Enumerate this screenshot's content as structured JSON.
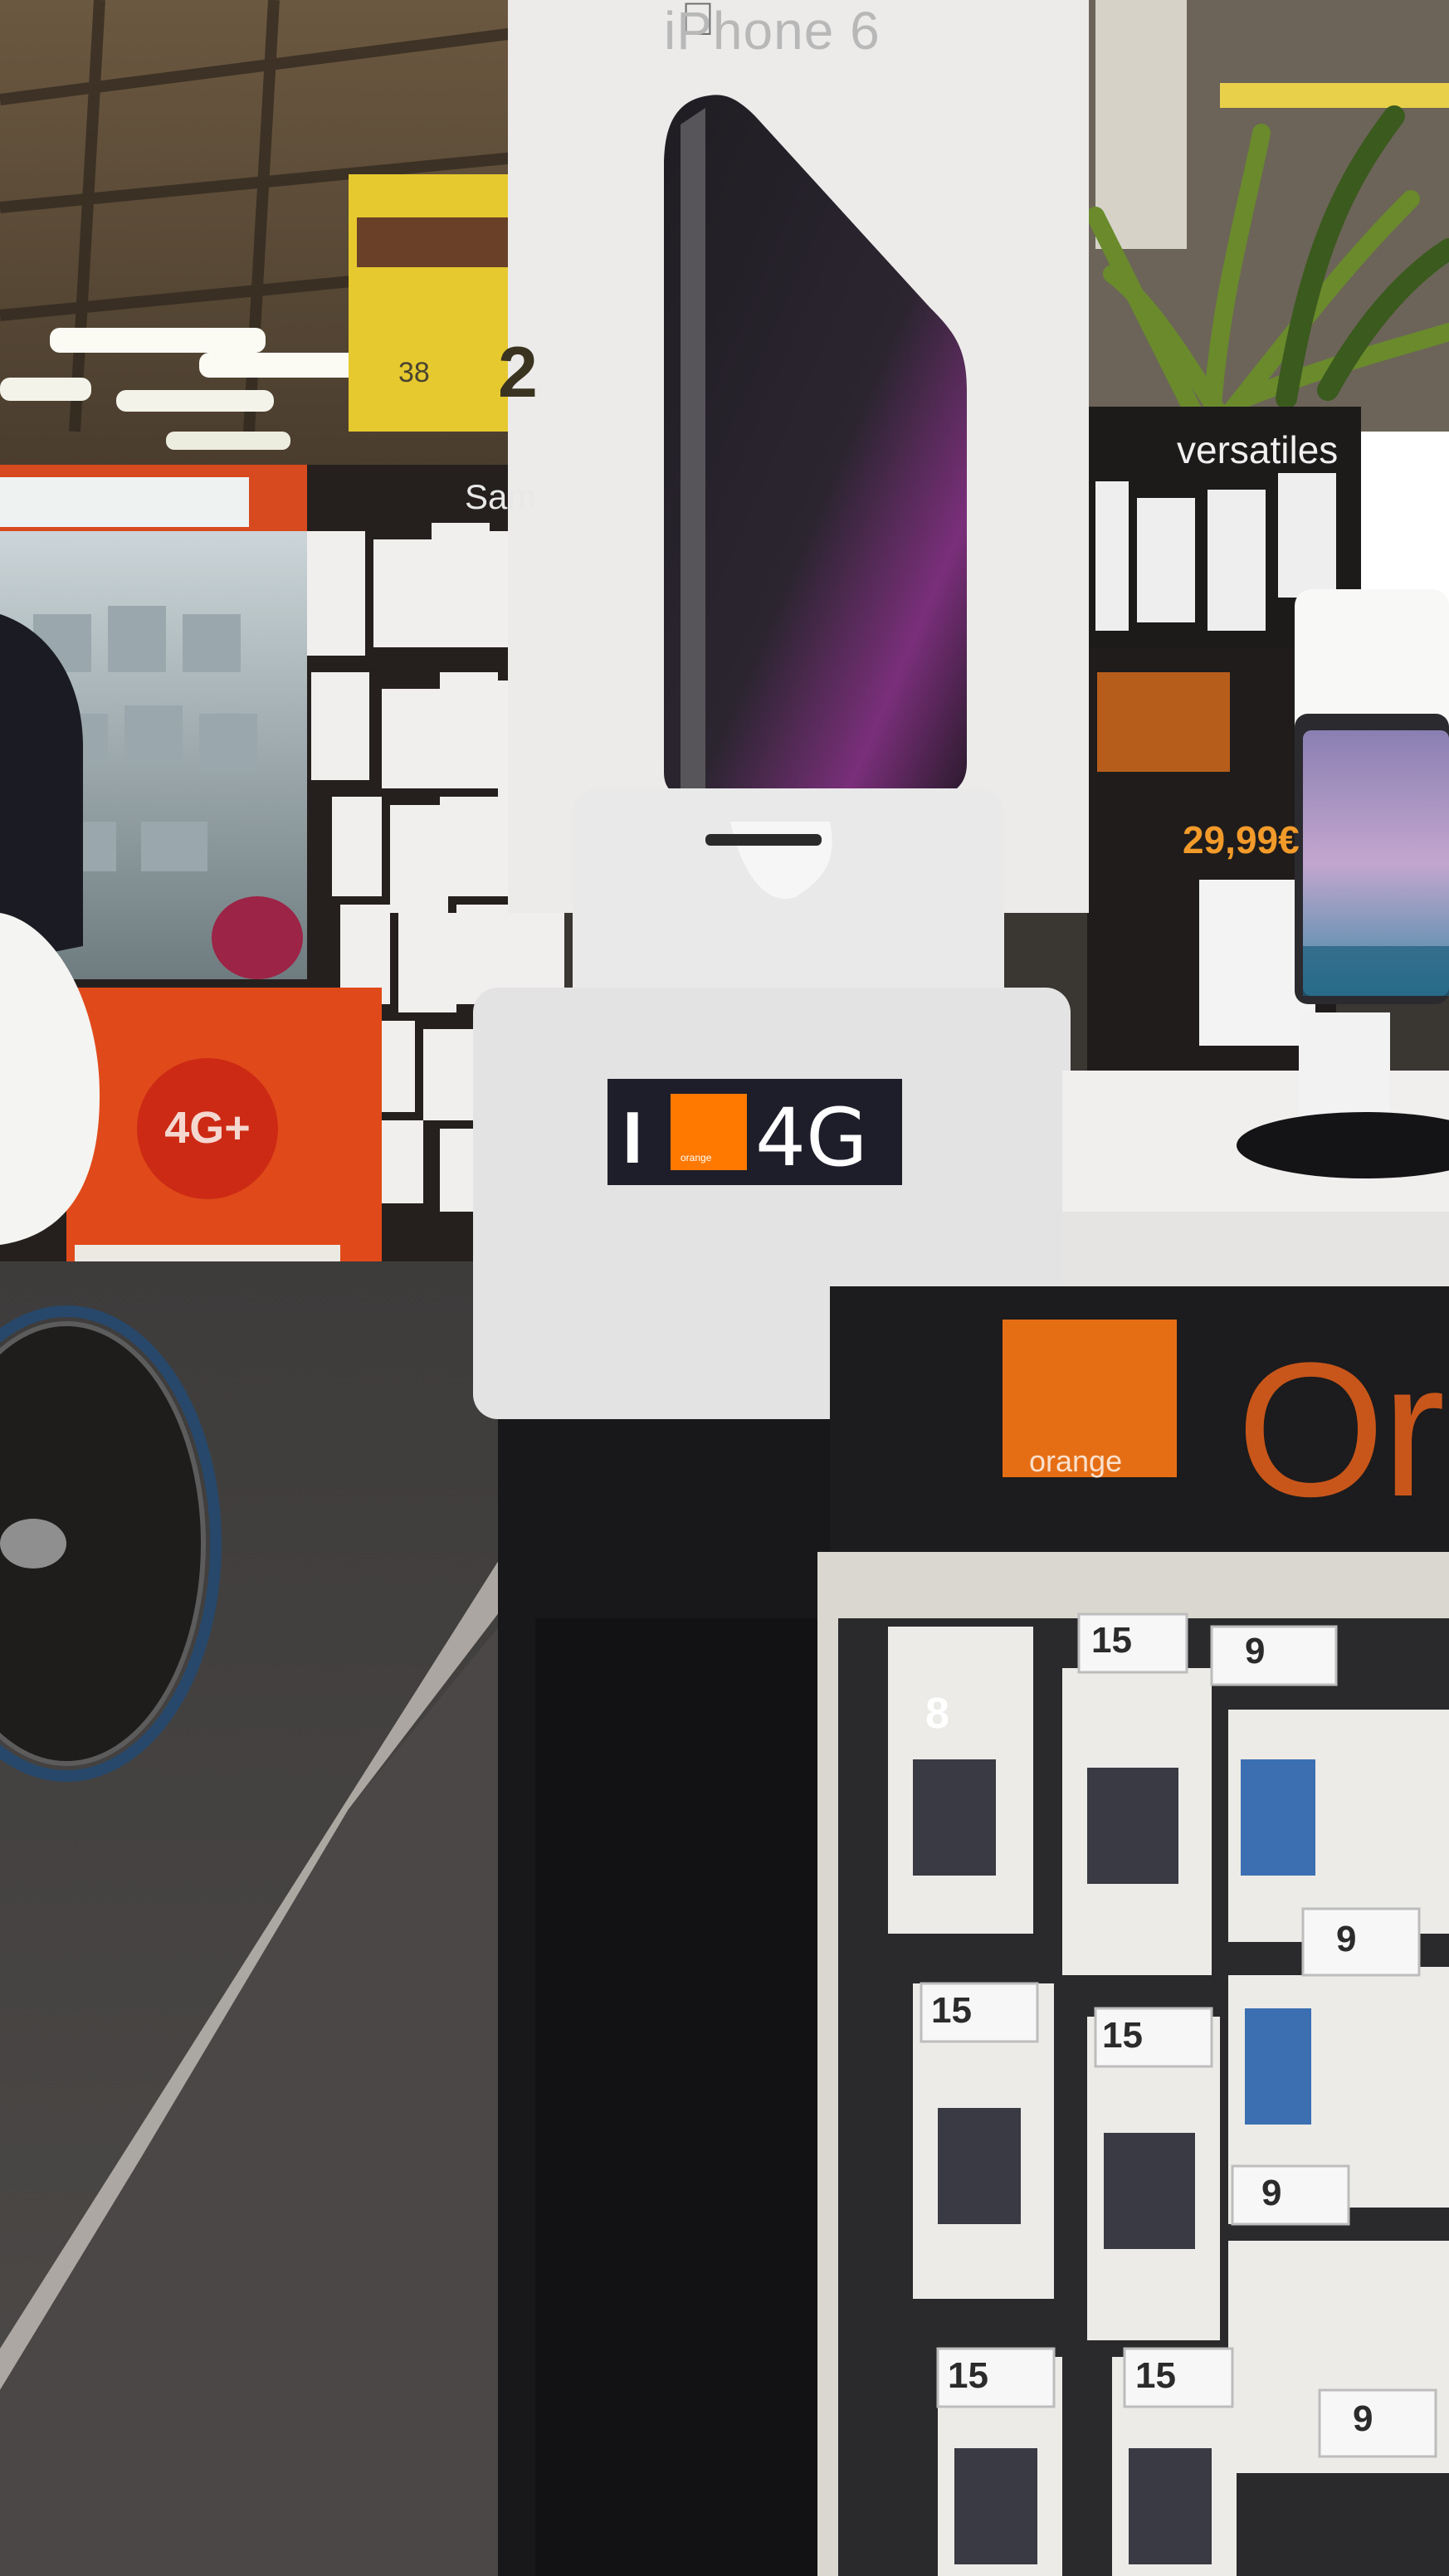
{
  "scene": {
    "description_free": true,
    "product_box_label": "iPhone 6",
    "yellow_sign": {
      "large": "2",
      "small": "38"
    },
    "brand_sign_left": "Sam",
    "brand_sign_right": "versatiles",
    "floor_badge": "4G+",
    "stand_logo": {
      "left": "I",
      "right": "4G",
      "orange_square_caption": "orange"
    },
    "counter_brand": {
      "logo_text": "orange",
      "big_text": "Or"
    },
    "promo_price": "29,99€",
    "price_tags": [
      {
        "value": "8"
      },
      {
        "value": "15"
      },
      {
        "value": "9"
      },
      {
        "value": "9"
      },
      {
        "value": "15"
      },
      {
        "value": "15"
      },
      {
        "value": "9"
      },
      {
        "value": "15"
      },
      {
        "value": "15"
      },
      {
        "value": "9"
      }
    ]
  },
  "colors": {
    "orange_brand": "#ff7900",
    "ceiling": "#5b4a37",
    "floor": "#454342",
    "counter_dark": "#1c1b1d",
    "stand_white": "#e9e9ea"
  }
}
